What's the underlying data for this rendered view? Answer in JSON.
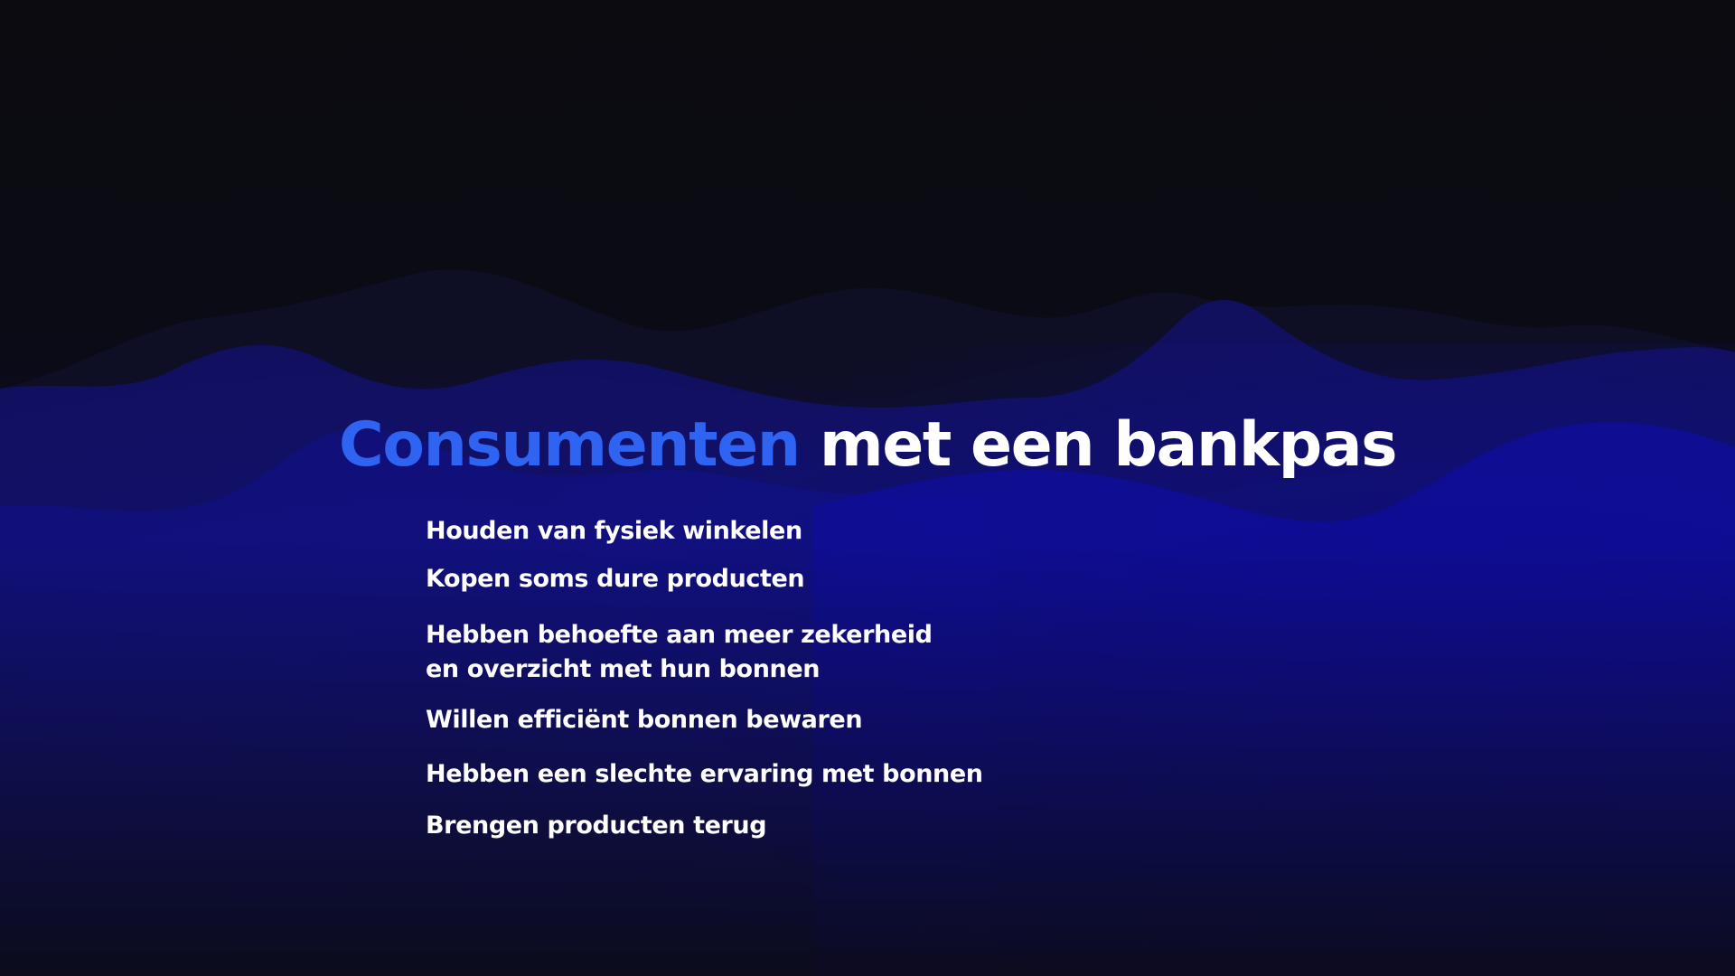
{
  "slide": {
    "title": {
      "accent": "Consumenten",
      "rest": "met een bankpas"
    },
    "points": [
      "Houden van fysiek winkelen",
      "Kopen soms dure producten",
      "Hebben behoefte aan meer zekerheid",
      "en overzicht met hun bonnen",
      "Willen efficiënt bonnen bewaren",
      "Hebben een slechte ervaring met bonnen",
      "Brengen producten terug"
    ]
  },
  "colors": {
    "background": "#0b0b12",
    "accent": "#2f63f2",
    "text": "#ffffff",
    "wave_deep": "#0c0c8a",
    "wave_mid": "#111070"
  }
}
